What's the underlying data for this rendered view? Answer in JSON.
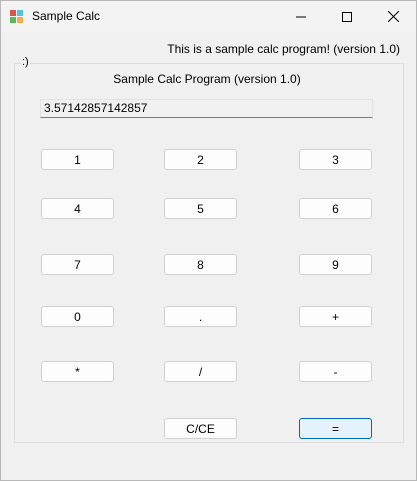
{
  "window": {
    "title": "Sample Calc",
    "icon": "app-icon",
    "controls": {
      "minimize": "minimize-icon",
      "maximize": "maximize-icon",
      "close": "close-icon"
    }
  },
  "header_label": "This is a sample calc program! (version 1.0)",
  "group_label": ":)",
  "program_label": "Sample Calc Program (version 1.0)",
  "display_value": "3.57142857142857",
  "buttons": {
    "one": "1",
    "two": "2",
    "three": "3",
    "four": "4",
    "five": "5",
    "six": "6",
    "seven": "7",
    "eight": "8",
    "nine": "9",
    "zero": "0",
    "dot": ".",
    "plus": "+",
    "multiply": "*",
    "divide": "/",
    "minus": "-",
    "clear": "C/CE",
    "equals": "="
  },
  "colors": {
    "accent": "#0067c0",
    "window_bg": "#f0f0f0"
  }
}
